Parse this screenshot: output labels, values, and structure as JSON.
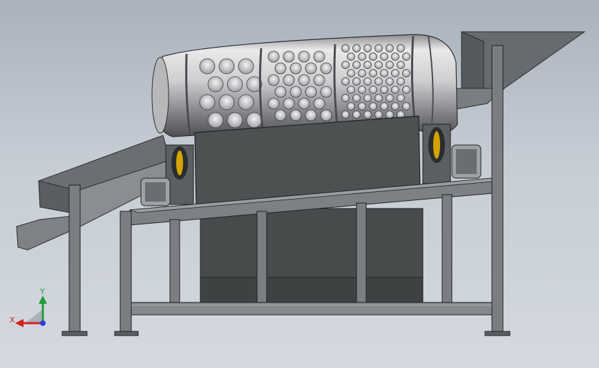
{
  "viewport": {
    "background_top": "#a9b2bd",
    "background_bottom": "#d4d9df"
  },
  "model": {
    "part_name": "trommel-screen-assembly",
    "metal_color": "#6f7377",
    "panel_color": "#4d5152",
    "drum_color": "#bfc0c2"
  },
  "triad": {
    "x_label": "X",
    "y_label": "Y",
    "x_color": "#d42020",
    "y_color": "#1f9e3a",
    "z_color": "#2a3de0"
  }
}
